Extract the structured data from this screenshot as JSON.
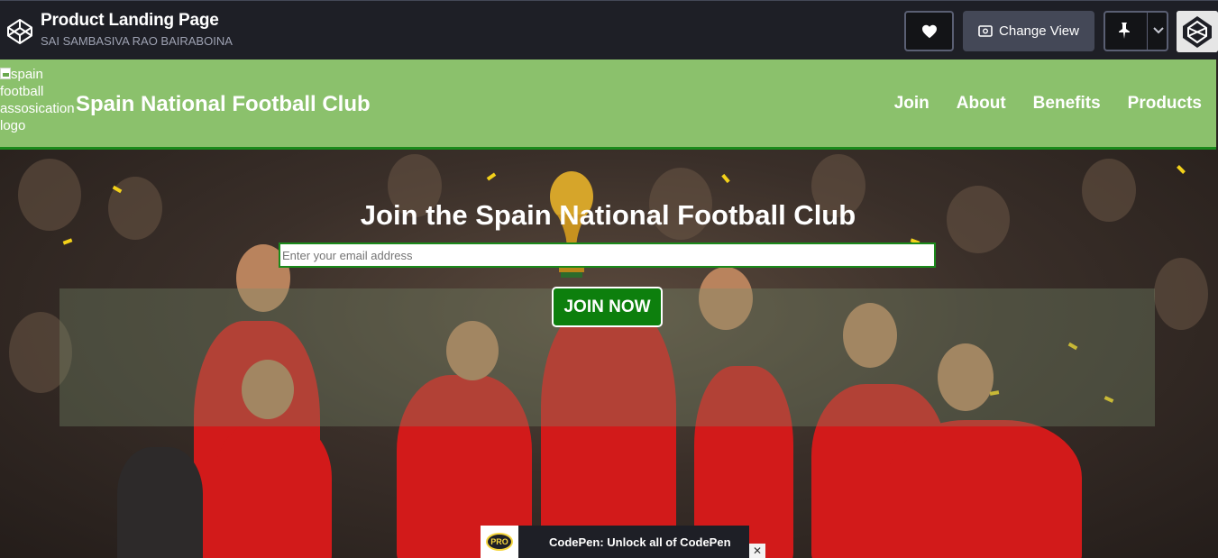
{
  "codepen": {
    "title": "Product Landing Page",
    "author": "SAI SAMBASIVA RAO BAIRABOINA",
    "change_view_label": "Change View",
    "heart_icon": "heart-icon",
    "pin_icon": "pin-icon"
  },
  "site": {
    "logo_alt": "spain football assosication logo",
    "title": "Spain National Football Club",
    "nav": [
      "Join",
      "About",
      "Benefits",
      "Products"
    ]
  },
  "hero": {
    "heading": "Join the Spain National Football Club",
    "email_placeholder": "Enter your email address",
    "button_label": "JOIN NOW"
  },
  "promo": {
    "badge": "PRO",
    "text": "CodePen: Unlock all of CodePen",
    "close": "✕"
  },
  "colors": {
    "header_bg": "#8bc16c",
    "accent_green": "#0d7f0d",
    "codepen_bar": "#1e1f26"
  }
}
